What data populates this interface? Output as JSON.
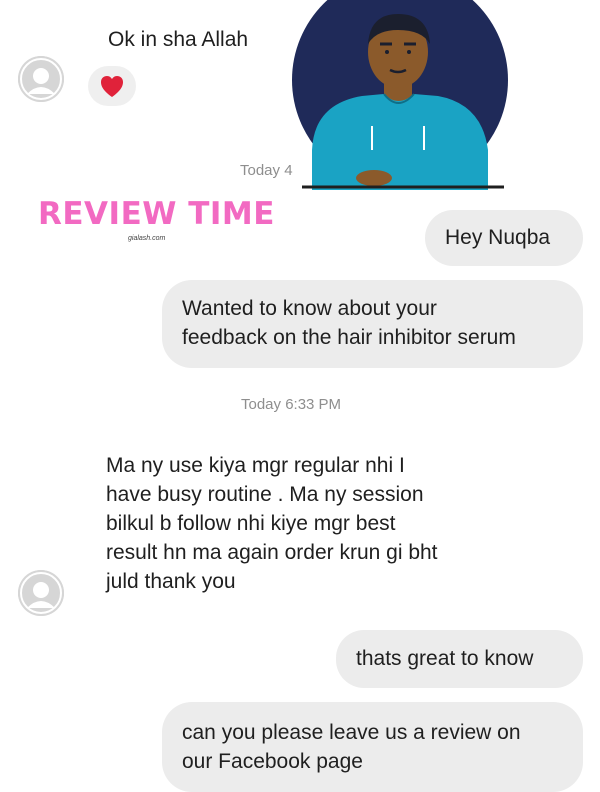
{
  "colors": {
    "incoming_bubble": "#ffffff",
    "outgoing_bubble": "#ececec",
    "avatar_placeholder": "#d6d6d6",
    "brand_pink": "#f26ac2",
    "illustration_circle": "#1f2a59",
    "shirt": "#1aa3c4",
    "skin": "#8b5a2b",
    "heart": "#e0223a"
  },
  "icons": {
    "avatar": "person-silhouette-icon",
    "reaction": "heart-icon"
  },
  "messages": [
    {
      "id": "msg-1",
      "direction": "incoming",
      "text": "Ok in sha Allah"
    },
    {
      "id": "msg-2",
      "direction": "outgoing",
      "text": "Hey Nuqba"
    },
    {
      "id": "msg-3",
      "direction": "outgoing",
      "lines": [
        "Wanted to know about your",
        "feedback on the hair inhibitor serum"
      ]
    },
    {
      "id": "msg-4",
      "direction": "incoming",
      "lines": [
        "Ma ny use kiya mgr regular nhi I",
        "have busy routine . Ma ny session",
        "bilkul b follow nhi kiye mgr best",
        "result hn ma again order krun gi bht",
        "juld thank you"
      ]
    },
    {
      "id": "msg-5",
      "direction": "outgoing",
      "text": "thats great to know"
    },
    {
      "id": "msg-6",
      "direction": "outgoing",
      "lines": [
        "can you please leave us a review on",
        "our Facebook page"
      ]
    }
  ],
  "timestamps": [
    "Today 4",
    "Today 6:33 PM"
  ],
  "overlay": {
    "title": "REVIEW TIME",
    "subtitle": "gialash.com"
  }
}
